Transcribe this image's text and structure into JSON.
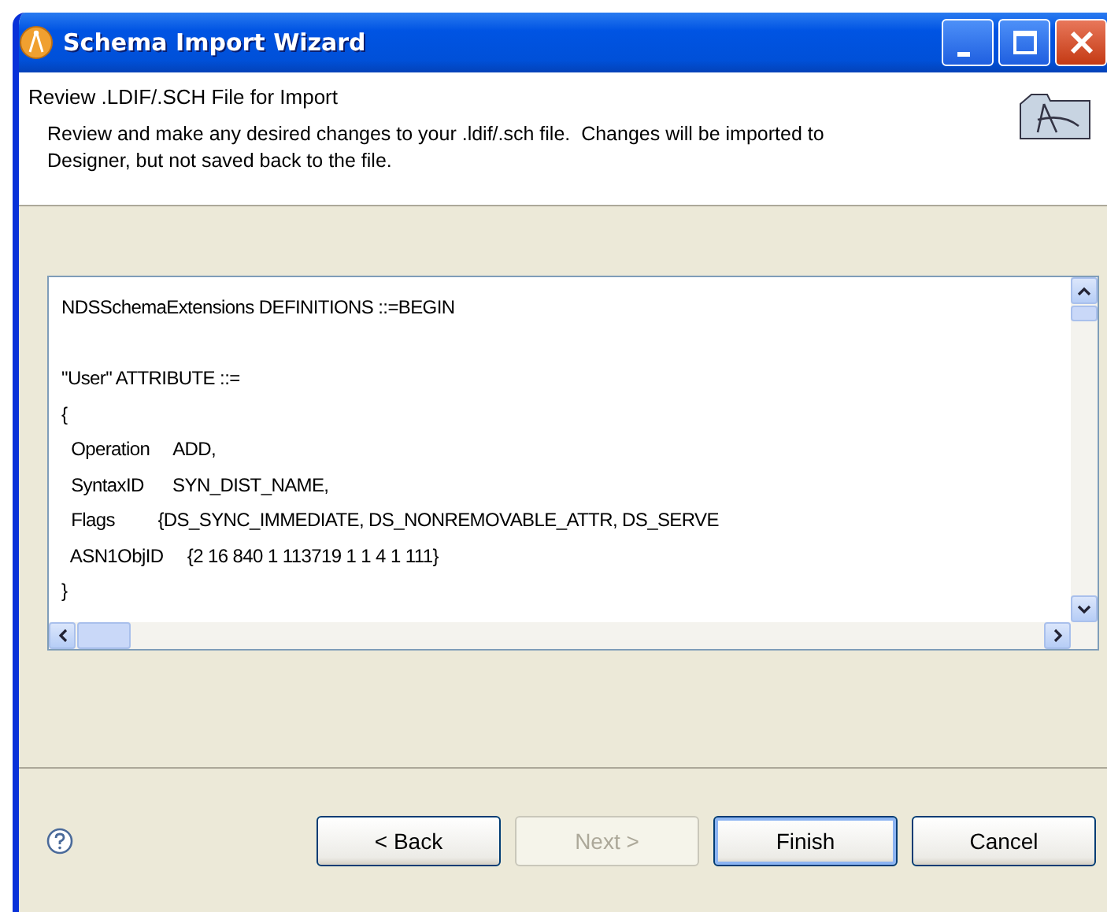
{
  "window": {
    "title": "Schema Import Wizard"
  },
  "header": {
    "title": "Review .LDIF/.SCH File for Import",
    "description": "Review and make any desired changes to your .ldif/.sch file.  Changes will be imported to Designer, but not saved back to the file."
  },
  "editor": {
    "blocks": [
      [
        "NDSSchemaExtensions DEFINITIONS ::=BEGIN"
      ],
      [
        "\"User\" ATTRIBUTE ::=",
        "{",
        "  Operation     ADD,",
        "  SyntaxID      SYN_DIST_NAME,",
        "  Flags         {DS_SYNC_IMMEDIATE, DS_NONREMOVABLE_ATTR, DS_SERVE",
        "  ASN1ObjID     {2 16 840 1 113719 1 1 4 1 111}",
        "}"
      ]
    ]
  },
  "buttons": [
    {
      "label": "< Back",
      "disabled": false,
      "default": false
    },
    {
      "label": "Next >",
      "disabled": true,
      "default": false
    },
    {
      "label": "Finish",
      "disabled": false,
      "default": true
    },
    {
      "label": "Cancel",
      "disabled": false,
      "default": false
    }
  ]
}
